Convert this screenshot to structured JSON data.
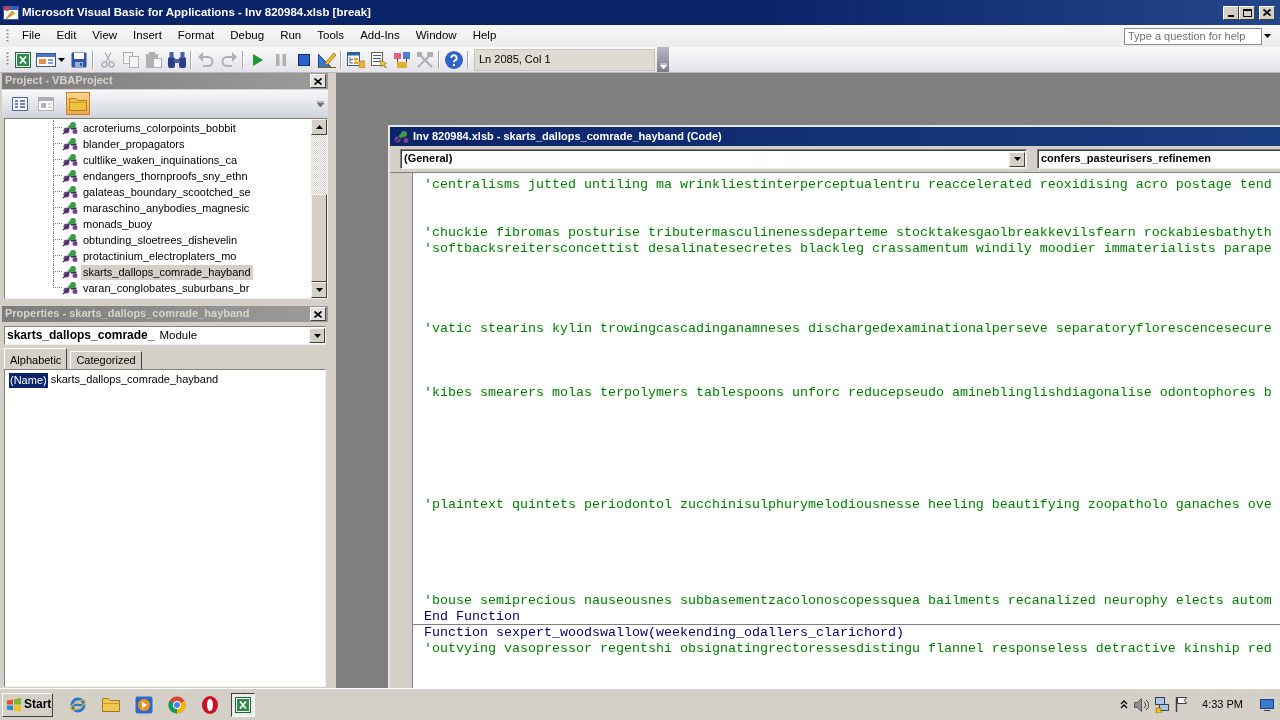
{
  "window": {
    "title": "Microsoft Visual Basic for Applications - Inv 820984.xlsb [break]"
  },
  "menu": [
    "File",
    "Edit",
    "View",
    "Insert",
    "Format",
    "Debug",
    "Run",
    "Tools",
    "Add-Ins",
    "Window",
    "Help"
  ],
  "help_search": {
    "placeholder": "Type a question for help"
  },
  "toolbar": {
    "buttons": [
      {
        "disabled": false
      },
      {
        "disabled": false
      },
      {
        "disabled": false
      },
      {
        "disabled": true
      },
      {
        "disabled": true
      },
      {
        "disabled": true
      },
      {
        "disabled": false
      },
      {
        "disabled": true
      },
      {
        "disabled": true
      },
      {
        "disabled": false
      },
      {
        "disabled": true
      },
      {
        "disabled": false
      },
      {
        "disabled": false
      },
      {
        "disabled": false
      },
      {
        "disabled": false
      },
      {
        "disabled": false
      },
      {
        "disabled": true
      },
      {
        "disabled": false
      }
    ],
    "position": "Ln 2085, Col 1"
  },
  "project_explorer": {
    "title": "Project - VBAProject",
    "buttons": [
      {
        "selected": false,
        "disabled": false
      },
      {
        "selected": false,
        "disabled": true
      },
      {
        "selected": true,
        "disabled": false
      }
    ],
    "items": [
      {
        "label": "acroteriums_colorpoints_bobbit",
        "selected": false
      },
      {
        "label": "blander_propagators",
        "selected": false
      },
      {
        "label": "cultlike_waken_inquinations_ca",
        "selected": false
      },
      {
        "label": "endangers_thornproofs_sny_ethn",
        "selected": false
      },
      {
        "label": "galateas_boundary_scootched_se",
        "selected": false
      },
      {
        "label": "maraschino_anybodies_magnesic",
        "selected": false
      },
      {
        "label": "monads_buoy",
        "selected": false
      },
      {
        "label": "obtunding_sloetrees_dishevelin",
        "selected": false
      },
      {
        "label": "protactinium_electroplaters_mo",
        "selected": false
      },
      {
        "label": "skarts_dallops_comrade_hayband",
        "selected": true
      },
      {
        "label": "varan_conglobates_suburbans_br",
        "selected": false
      }
    ]
  },
  "properties": {
    "title": "Properties - skarts_dallops_comrade_hayband",
    "object": {
      "name": "skarts_dallops_comrade_",
      "type": "Module"
    },
    "tabs": [
      {
        "label": "Alphabetic",
        "selected": true
      },
      {
        "label": "Categorized",
        "selected": false
      }
    ],
    "rows": [
      {
        "name": "(Name)",
        "value": "skarts_dallops_comrade_hayband",
        "selected": true
      }
    ]
  },
  "code_window": {
    "title": "Inv 820984.xlsb - skarts_dallops_comrade_hayband (Code)",
    "object_box": "(General)",
    "procedure_box": "confers_pasteurisers_refinemen",
    "procedures": [
      {
        "lines": [
          {
            "kind": "comment",
            "text": "'centralisms jutted untiling ma wrinkliestinterperceptualentru reaccelerated reoxidising acro postage tend"
          },
          {
            "kind": "blank"
          },
          {
            "kind": "blank"
          },
          {
            "kind": "comment",
            "text": "'chuckie fibromas posturise tributermasculinenessdeparteme stocktakesgaolbreakkevilsfearn rockabiesbathyth"
          },
          {
            "kind": "comment",
            "text": "'softbacksreitersconcettist desalinatesecretes blackleg crassamentum windily moodier immaterialists parape"
          },
          {
            "kind": "blank"
          },
          {
            "kind": "blank"
          },
          {
            "kind": "blank"
          },
          {
            "kind": "blank"
          },
          {
            "kind": "comment",
            "text": "'vatic stearins kylin trowingcascadinganamneses dischargedexaminationalperseve separatoryflorescencesecure"
          },
          {
            "kind": "blank"
          },
          {
            "kind": "blank"
          },
          {
            "kind": "blank"
          },
          {
            "kind": "comment",
            "text": "'kibes smearers molas terpolymers tablespoons unforc reducepseudo amineblinglishdiagonalise odontophores b"
          },
          {
            "kind": "blank"
          },
          {
            "kind": "blank"
          },
          {
            "kind": "blank"
          },
          {
            "kind": "blank"
          },
          {
            "kind": "blank"
          },
          {
            "kind": "blank"
          },
          {
            "kind": "comment",
            "text": "'plaintext quintets periodontol zucchinisulphurymelodiousnesse heeling beautifying zoopatholo ganaches ove"
          },
          {
            "kind": "blank"
          },
          {
            "kind": "blank"
          },
          {
            "kind": "blank"
          },
          {
            "kind": "blank"
          },
          {
            "kind": "blank"
          },
          {
            "kind": "comment",
            "text": "'bouse semiprecious nauseousnes subbasementzacolonoscopessquea bailments recanalized neurophy elects autom"
          },
          {
            "kind": "code",
            "text": "End Function"
          }
        ]
      },
      {
        "lines": [
          {
            "kind": "code",
            "text": "Function sexpert_woodswallow(weekending_odallers_clarichord)"
          },
          {
            "kind": "comment",
            "text": "'outvying vasopressor regentshi obsignatingrectoressesdistingu flannel responseless detractive kinship red"
          }
        ]
      }
    ]
  },
  "taskbar": {
    "start": "Start",
    "apps": [
      {
        "active": false
      },
      {
        "active": false
      },
      {
        "active": false
      },
      {
        "active": false
      },
      {
        "active": false
      },
      {
        "active": true
      }
    ],
    "clock": "4:33 PM"
  }
}
